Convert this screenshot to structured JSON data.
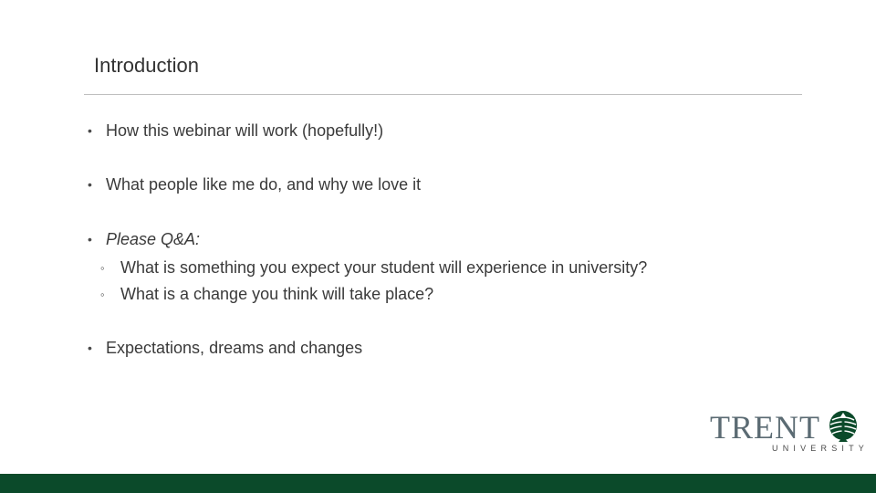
{
  "slide": {
    "title": "Introduction",
    "bullets": [
      {
        "text": "How this webinar will work (hopefully!)"
      },
      {
        "text": "What people like me do, and why we love it"
      },
      {
        "text": "Please Q&A:"
      },
      {
        "text": "Expectations, dreams and changes"
      }
    ],
    "sub_bullets": [
      {
        "text": "What is something you expect your student will experience in university?"
      },
      {
        "text": "What is a change you think will take place?"
      }
    ],
    "bullet_glyph": "•",
    "sub_bullet_glyph": "◦"
  },
  "logo": {
    "wordmark": "TRENT",
    "subtitle": "UNIVERSITY",
    "icon": "trent-emblem-icon"
  },
  "colors": {
    "brand_green": "#0b4a2a",
    "logo_gray": "#5b6b73",
    "text": "#3a3a3a"
  }
}
